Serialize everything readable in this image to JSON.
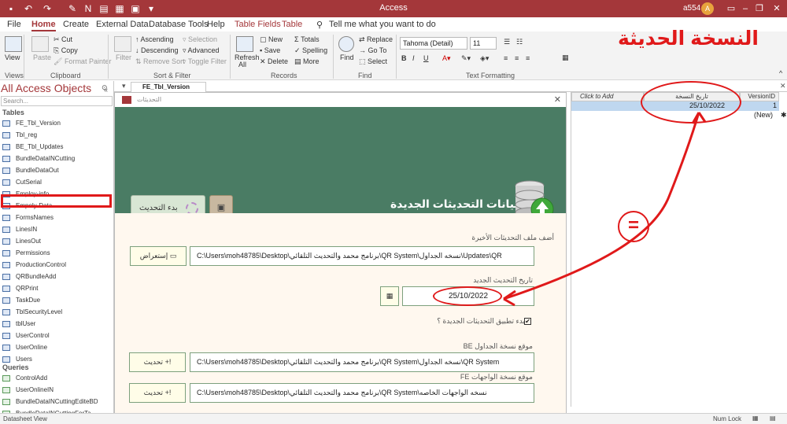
{
  "app": {
    "title": "Access",
    "user": "a554",
    "avatar_letter": "A"
  },
  "ribbon_tabs": [
    "File",
    "Home",
    "Create",
    "External Data",
    "Database Tools",
    "Help",
    "Table Fields",
    "Table"
  ],
  "tell_me": "Tell me what you want to do",
  "ribbon": {
    "views": {
      "label": "View",
      "group": "Views"
    },
    "clipboard": {
      "paste": "Paste",
      "cut": "Cut",
      "copy": "Copy",
      "format_painter": "Format Painter",
      "group": "Clipboard"
    },
    "sort_filter": {
      "filter": "Filter",
      "ascending": "Ascending",
      "descending": "Descending",
      "remove_sort": "Remove Sort",
      "selection": "Selection",
      "advanced": "Advanced",
      "toggle_filter": "Toggle Filter",
      "group": "Sort & Filter"
    },
    "records": {
      "refresh": "Refresh",
      "refresh_all": "All",
      "new": "New",
      "save": "Save",
      "delete": "Delete",
      "totals": "Totals",
      "spelling": "Spelling",
      "more": "More",
      "group": "Records"
    },
    "find": {
      "find": "Find",
      "replace": "Replace",
      "goto": "Go To",
      "select": "Select",
      "group": "Find"
    },
    "text_formatting": {
      "font": "Tahoma (Detail)",
      "size": "11",
      "group": "Text Formatting"
    }
  },
  "nav": {
    "title": "All Access Objects",
    "search_placeholder": "Search...",
    "tables_label": "Tables",
    "tables": [
      "FE_Tbl_Version",
      "Tbl_reg",
      "BE_Tbl_Updates",
      "BundleDataINCutting",
      "BundleDataOut",
      "CutSerial",
      "Employ-info",
      "Empoly-Data",
      "FormsNames",
      "LinesIN",
      "LinesOut",
      "Permissions",
      "ProductionControl",
      "QRBundleAdd",
      "QRPrint",
      "TaskDue",
      "TblSecurityLevel",
      "tblUser",
      "UserControl",
      "UserOnline",
      "Users"
    ],
    "queries_label": "Queries",
    "queries": [
      "ControlAdd",
      "UserOnlineIN",
      "BundleDataINCuttingEditeBD",
      "BundleDataINCuttingForTa..."
    ]
  },
  "doc_tab": "FE_Tbl_Version",
  "form": {
    "window_title": "التحديثات",
    "header_title": "بيانات التحديثات الجديدة",
    "update_button": "بدء التحديث",
    "save_icon": "floppy-icon",
    "last_file_label": "أضف ملف التحديثات الأخيرة",
    "last_file_path": "C:\\Users\\moh48785\\Desktop\\برنامج محمد والتحديث التلقائي\\QR System\\نسخه الجداول\\Updates\\QR",
    "browse_button": "إستعراض",
    "new_date_label": "تاريخ التحديث الجديد",
    "new_date_value": "25/10/2022",
    "apply_label": "بدء تطبيق التحديثات الجديدة ؟",
    "apply_checked": true,
    "be_label": "موقع نسخة الجداول BE",
    "be_path": "C:\\Users\\moh48785\\Desktop\\برنامج محمد والتحديث التلقائي\\QR System\\نسخه الجداول\\QR System",
    "fe_label": "موقع نسخة الواجهات FE",
    "fe_path": "C:\\Users\\moh48785\\Desktop\\برنامج محمد والتحديث التلقائي\\QR System\\نسخه الواجهات الخاصه",
    "update_small": "تحديث"
  },
  "datasheet": {
    "headers": [
      "Click to Add",
      "تاريخ النسخة",
      "VersionID"
    ],
    "row_date": "25/10/2022",
    "row_id": "1",
    "new_row": "(New)"
  },
  "annotation": {
    "big_title": "النسخة الحديثة",
    "equals": "="
  },
  "status": {
    "left": "Datasheet View",
    "numlock": "Num Lock"
  },
  "colors": {
    "accent": "#a4373a",
    "form_header": "#4a7c64",
    "annot_red": "#e0191a"
  }
}
